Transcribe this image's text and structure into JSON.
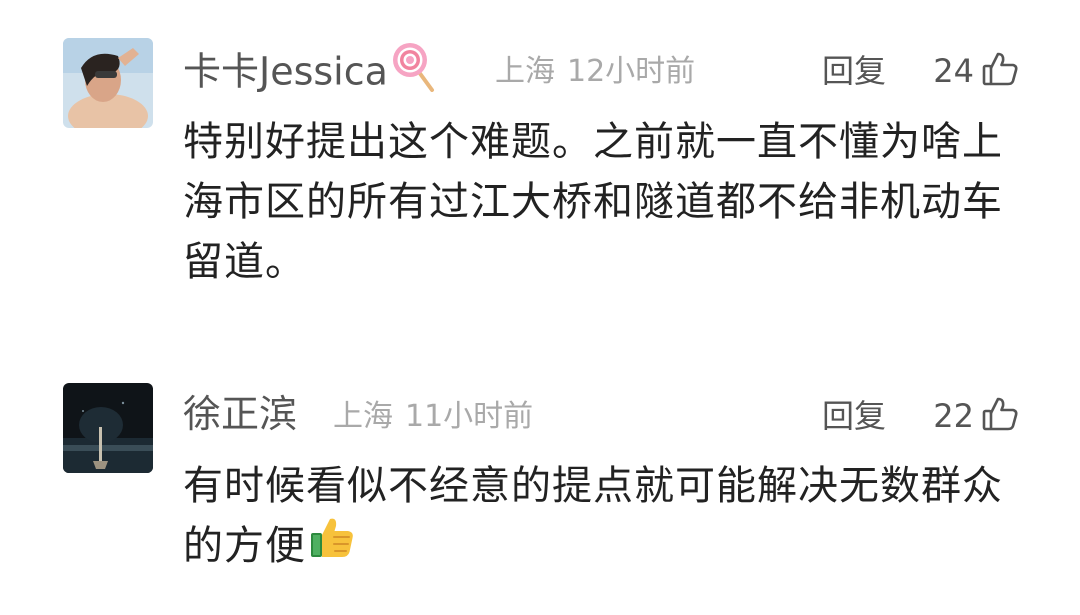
{
  "comments": [
    {
      "username": "卡卡Jessica",
      "username_emoji": "lollipop-icon",
      "location": "上海",
      "time": "12小时前",
      "reply_label": "回复",
      "likes": "24",
      "text": "特别好提出这个难题。之前就一直不懂为啥上海市区的所有过江大桥和隧道都不给非机动车留道。"
    },
    {
      "username": "徐正滨",
      "location": "上海",
      "time": "11小时前",
      "reply_label": "回复",
      "likes": "22",
      "text": "有时候看似不经意的提点就可能解决无数群众的方便",
      "text_emoji": "thumbs-up-icon"
    }
  ],
  "colors": {
    "username": "#555555",
    "meta": "#a9a9a9",
    "body_text": "#222222",
    "background": "#ffffff"
  }
}
